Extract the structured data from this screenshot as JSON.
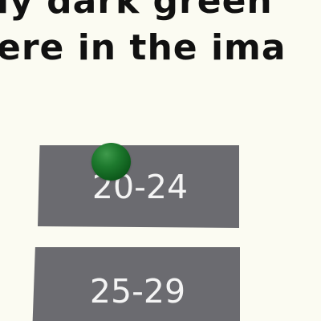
{
  "question": {
    "line1": "ly dark green",
    "line2": "ere in the ima"
  },
  "options": [
    {
      "label": "20-24"
    },
    {
      "label": "25-29"
    }
  ],
  "marker": {
    "color": "#1e7a2e",
    "icon": "green-sphere-icon"
  },
  "colors": {
    "background": "#fbfbf2",
    "button": "#6b6b70",
    "button_text": "#f4f4f4",
    "question_text": "#111111"
  }
}
